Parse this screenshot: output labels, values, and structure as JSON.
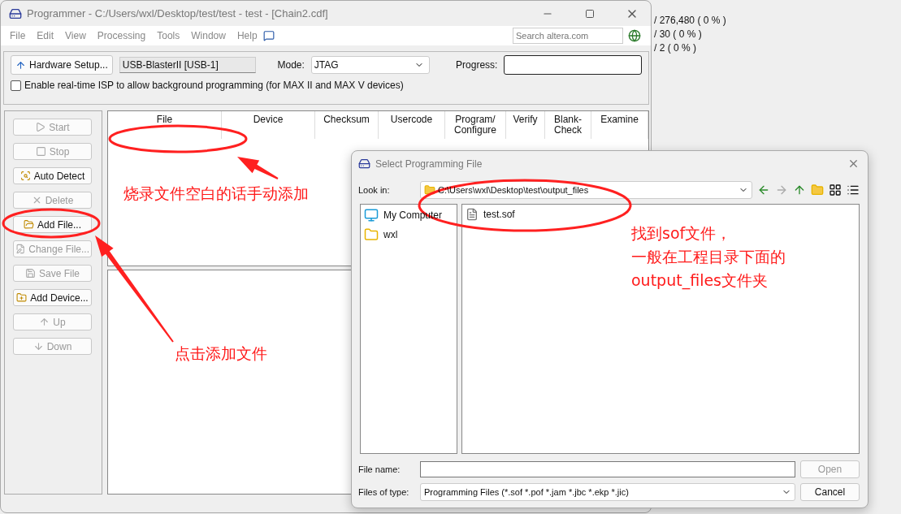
{
  "background_readouts": [
    "/ 276,480 ( 0 % )",
    "/ 30 ( 0 % )",
    "/ 2 ( 0 % )"
  ],
  "window": {
    "title": "Programmer - C:/Users/wxl/Desktop/test/test - test - [Chain2.cdf]"
  },
  "menu": [
    "File",
    "Edit",
    "View",
    "Processing",
    "Tools",
    "Window",
    "Help"
  ],
  "search": {
    "placeholder": "Search altera.com"
  },
  "toolbar": {
    "hardware_button": "Hardware Setup...",
    "hardware": "USB-BlasterII [USB-1]",
    "mode_label": "Mode:",
    "mode": "JTAG",
    "progress_label": "Progress:",
    "progress": {
      "level": 0
    },
    "isp": {
      "label": "Enable real-time ISP to allow background programming (for MAX II and MAX V devices)",
      "checked": false
    }
  },
  "side_buttons": [
    {
      "label": "Start",
      "disabled": true
    },
    {
      "label": "Stop",
      "disabled": true
    },
    {
      "label": "Auto Detect",
      "disabled": false
    },
    {
      "label": "Delete",
      "disabled": true
    },
    {
      "label": "Add File...",
      "disabled": false
    },
    {
      "label": "Change File...",
      "disabled": true
    },
    {
      "label": "Save File",
      "disabled": true
    },
    {
      "label": "Add Device...",
      "disabled": false
    },
    {
      "label": "Up",
      "disabled": true
    },
    {
      "label": "Down",
      "disabled": true
    }
  ],
  "table": {
    "columns": [
      "File",
      "Device",
      "Checksum",
      "Usercode",
      "Program/\nConfigure",
      "Verify",
      "Blank-\nCheck",
      "Examine"
    ]
  },
  "dialog": {
    "title": "Select Programming File",
    "look_in_label": "Look in:",
    "look_in": "C:\\Users\\wxl\\Desktop\\test\\output_files",
    "places": [
      {
        "label": "My Computer",
        "kind": "computer"
      },
      {
        "label": "wxl",
        "kind": "folder"
      }
    ],
    "files": [
      "test.sof"
    ],
    "file_name_label": "File name:",
    "open_button": {
      "label": "Open",
      "disabled": true
    },
    "file_type_label": "Files of type:",
    "file_type": "Programming Files (*.sof *.pof *.jam *.jbc *.ekp *.jic)",
    "cancel_button": "Cancel"
  },
  "annotations": [
    "烧录文件空白的话手动添加",
    "点击添加文件"
  ],
  "dialog_note": [
    "找到sof文件，",
    "一般在工程目录下面的",
    "output_files文件夹"
  ]
}
